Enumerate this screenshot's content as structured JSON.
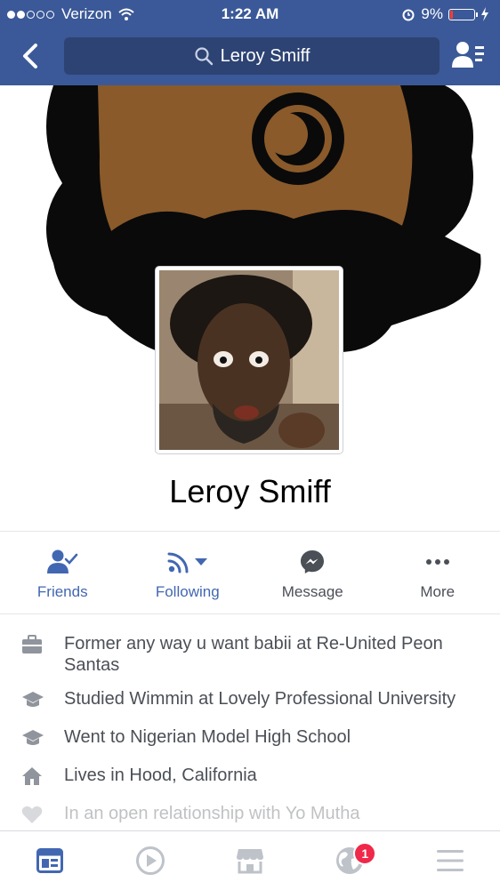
{
  "status_bar": {
    "carrier": "Verizon",
    "time": "1:22 AM",
    "battery": "9%"
  },
  "header": {
    "search_text": "Leroy Smiff"
  },
  "profile": {
    "name": "Leroy Smiff"
  },
  "actions": [
    {
      "label": "Friends",
      "icon": "friends-check-icon"
    },
    {
      "label": "Following",
      "icon": "rss-following-icon"
    },
    {
      "label": "Message",
      "icon": "messenger-icon"
    },
    {
      "label": "More",
      "icon": "more-dots-icon"
    }
  ],
  "info": [
    {
      "icon": "briefcase-icon",
      "text": "Former any way u want babii at Re-United Peon Santas"
    },
    {
      "icon": "graduation-cap-icon",
      "text": "Studied Wimmin at Lovely Professional University"
    },
    {
      "icon": "graduation-cap-icon",
      "text": "Went to Nigerian Model High School"
    },
    {
      "icon": "home-icon",
      "text": "Lives in Hood, California"
    },
    {
      "icon": "heart-icon",
      "text": "In an open relationship with Yo Mutha"
    }
  ],
  "bottom_nav": {
    "notifications_badge": "1"
  },
  "colors": {
    "brand": "#3b5998",
    "accent": "#4267b2",
    "badge": "#f02849"
  }
}
